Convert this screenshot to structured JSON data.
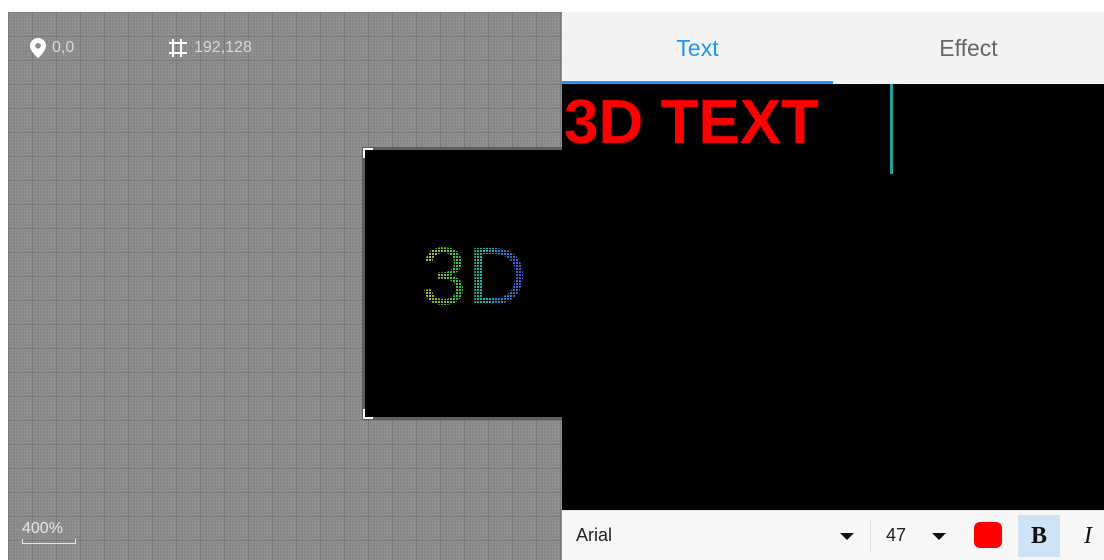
{
  "canvas": {
    "position_readout": "0,0",
    "size_readout": "192,128",
    "zoom_label": "400%",
    "preview_text": "3D"
  },
  "tabs": [
    {
      "label": "Text",
      "active": true
    },
    {
      "label": "Effect",
      "active": false
    }
  ],
  "editor": {
    "text_value": "3D TEXT",
    "text_color": "#ff0000"
  },
  "toolbar": {
    "font_name": "Arial",
    "font_size": "47",
    "color": "#ff0000",
    "bold_label": "B",
    "italic_label": "I",
    "bold_active": true
  },
  "icons": {
    "position": "map-pin-icon",
    "size": "crop-grid-icon",
    "font_dropdown": "caret-down-icon",
    "size_dropdown": "caret-down-icon"
  },
  "colors": {
    "accent": "#2196f3",
    "caret": "#1aa39a"
  }
}
